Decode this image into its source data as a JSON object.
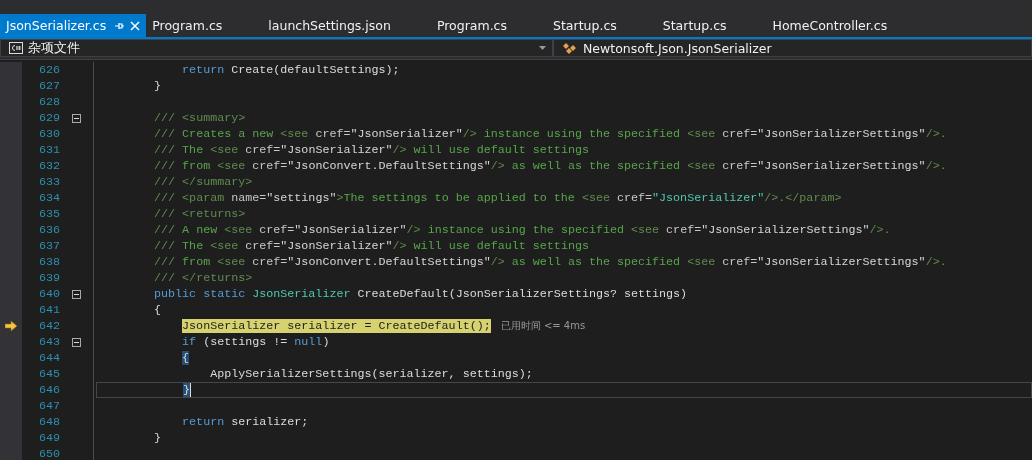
{
  "tabs": [
    {
      "label": "JsonSerializer.cs",
      "selected": true
    },
    {
      "label": "Program.cs",
      "selected": false
    },
    {
      "label": "launchSettings.json",
      "selected": false
    },
    {
      "label": "Program.cs",
      "selected": false
    },
    {
      "label": "Startup.cs",
      "selected": false
    },
    {
      "label": "Startup.cs",
      "selected": false
    },
    {
      "label": "HomeController.cs",
      "selected": false
    }
  ],
  "navigation_bar": {
    "project": "杂项文件",
    "type": "Newtonsoft.Json.JsonSerializer"
  },
  "editor": {
    "lines": [
      {
        "number": "626",
        "kind": "statement",
        "tokens": [
          {
            "kind": "kw",
            "text": "return"
          },
          {
            "kind": "plain",
            "text": " Create(defaultSettings);"
          }
        ]
      },
      {
        "number": "627",
        "kind": "member",
        "tokens": [
          {
            "kind": "plain",
            "text": "}"
          }
        ]
      },
      {
        "number": "628",
        "kind": "blank"
      },
      {
        "number": "629",
        "kind": "member",
        "fold": true,
        "tokens": [
          {
            "kind": "doc",
            "text": "/// <summary>"
          }
        ]
      },
      {
        "number": "630",
        "kind": "member",
        "tokens": [
          {
            "kind": "doc",
            "text": "/// "
          },
          {
            "kind": "doctext",
            "text": "Creates a new "
          },
          {
            "kind": "doc",
            "text": "<see "
          },
          {
            "kind": "attr",
            "text": "cref="
          },
          {
            "kind": "str",
            "text": "\"JsonSerializer\""
          },
          {
            "kind": "doc",
            "text": "/> "
          },
          {
            "kind": "doctext",
            "text": "instance using the specified "
          },
          {
            "kind": "doc",
            "text": "<see "
          },
          {
            "kind": "attr",
            "text": "cref="
          },
          {
            "kind": "str",
            "text": "\"JsonSerializerSettings\""
          },
          {
            "kind": "doc",
            "text": "/>."
          }
        ]
      },
      {
        "number": "631",
        "kind": "member",
        "tokens": [
          {
            "kind": "doc",
            "text": "/// "
          },
          {
            "kind": "doctext",
            "text": "The "
          },
          {
            "kind": "doc",
            "text": "<see "
          },
          {
            "kind": "attr",
            "text": "cref="
          },
          {
            "kind": "str",
            "text": "\"JsonSerializer\""
          },
          {
            "kind": "doc",
            "text": "/> "
          },
          {
            "kind": "doctext",
            "text": "will use default settings"
          }
        ]
      },
      {
        "number": "632",
        "kind": "member",
        "tokens": [
          {
            "kind": "doc",
            "text": "/// "
          },
          {
            "kind": "doctext",
            "text": "from "
          },
          {
            "kind": "doc",
            "text": "<see "
          },
          {
            "kind": "attr",
            "text": "cref="
          },
          {
            "kind": "str",
            "text": "\"JsonConvert.DefaultSettings\""
          },
          {
            "kind": "doc",
            "text": "/> "
          },
          {
            "kind": "doctext",
            "text": "as well as the specified "
          },
          {
            "kind": "doc",
            "text": "<see "
          },
          {
            "kind": "attr",
            "text": "cref="
          },
          {
            "kind": "str",
            "text": "\"JsonSerializerSettings\""
          },
          {
            "kind": "doc",
            "text": "/>."
          }
        ]
      },
      {
        "number": "633",
        "kind": "member",
        "tokens": [
          {
            "kind": "doc",
            "text": "/// </summary>"
          }
        ]
      },
      {
        "number": "634",
        "kind": "member",
        "tokens": [
          {
            "kind": "doc",
            "text": "/// <param "
          },
          {
            "kind": "attr",
            "text": "name="
          },
          {
            "kind": "str",
            "text": "\"settings\""
          },
          {
            "kind": "doc",
            "text": ">"
          },
          {
            "kind": "doctext",
            "text": "The settings to be applied to the "
          },
          {
            "kind": "doc",
            "text": "<see "
          },
          {
            "kind": "attr",
            "text": "cref="
          },
          {
            "kind": "ref",
            "text": "\"JsonSerializer\""
          },
          {
            "kind": "doc",
            "text": "/>.</param>"
          }
        ]
      },
      {
        "number": "635",
        "kind": "member",
        "tokens": [
          {
            "kind": "doc",
            "text": "/// <returns>"
          }
        ]
      },
      {
        "number": "636",
        "kind": "member",
        "tokens": [
          {
            "kind": "doc",
            "text": "/// "
          },
          {
            "kind": "doctext",
            "text": "A new "
          },
          {
            "kind": "doc",
            "text": "<see "
          },
          {
            "kind": "attr",
            "text": "cref="
          },
          {
            "kind": "str",
            "text": "\"JsonSerializer\""
          },
          {
            "kind": "doc",
            "text": "/> "
          },
          {
            "kind": "doctext",
            "text": "instance using the specified "
          },
          {
            "kind": "doc",
            "text": "<see "
          },
          {
            "kind": "attr",
            "text": "cref="
          },
          {
            "kind": "str",
            "text": "\"JsonSerializerSettings\""
          },
          {
            "kind": "doc",
            "text": "/>."
          }
        ]
      },
      {
        "number": "637",
        "kind": "member",
        "tokens": [
          {
            "kind": "doc",
            "text": "/// "
          },
          {
            "kind": "doctext",
            "text": "The "
          },
          {
            "kind": "doc",
            "text": "<see "
          },
          {
            "kind": "attr",
            "text": "cref="
          },
          {
            "kind": "str",
            "text": "\"JsonSerializer\""
          },
          {
            "kind": "doc",
            "text": "/> "
          },
          {
            "kind": "doctext",
            "text": "will use default settings"
          }
        ]
      },
      {
        "number": "638",
        "kind": "member",
        "tokens": [
          {
            "kind": "doc",
            "text": "/// "
          },
          {
            "kind": "doctext",
            "text": "from "
          },
          {
            "kind": "doc",
            "text": "<see "
          },
          {
            "kind": "attr",
            "text": "cref="
          },
          {
            "kind": "str",
            "text": "\"JsonConvert.DefaultSettings\""
          },
          {
            "kind": "doc",
            "text": "/> "
          },
          {
            "kind": "doctext",
            "text": "as well as the specified "
          },
          {
            "kind": "doc",
            "text": "<see "
          },
          {
            "kind": "attr",
            "text": "cref="
          },
          {
            "kind": "str",
            "text": "\"JsonSerializerSettings\""
          },
          {
            "kind": "doc",
            "text": "/>."
          }
        ]
      },
      {
        "number": "639",
        "kind": "member",
        "tokens": [
          {
            "kind": "doc",
            "text": "/// </returns>"
          }
        ]
      },
      {
        "number": "640",
        "kind": "member",
        "fold": true,
        "tokens": [
          {
            "kind": "kw",
            "text": "public static "
          },
          {
            "kind": "type",
            "text": "JsonSerializer"
          },
          {
            "kind": "plain",
            "text": " CreateDefault(JsonSerializerSettings? settings)"
          }
        ]
      },
      {
        "number": "641",
        "kind": "member",
        "tokens": [
          {
            "kind": "plain",
            "text": "{"
          }
        ]
      },
      {
        "number": "642",
        "kind": "statement",
        "current": true,
        "hint": "已用时间 <= 4ms",
        "tokens": [
          {
            "kind": "exec",
            "text": "JsonSerializer serializer = CreateDefault();"
          }
        ]
      },
      {
        "number": "643",
        "kind": "statement",
        "fold": true,
        "tokens": [
          {
            "kind": "kw",
            "text": "if"
          },
          {
            "kind": "plain",
            "text": " (settings != "
          },
          {
            "kind": "kw",
            "text": "null"
          },
          {
            "kind": "plain",
            "text": ")"
          }
        ]
      },
      {
        "number": "644",
        "kind": "statement",
        "tokens": [
          {
            "kind": "brace",
            "text": "{"
          }
        ]
      },
      {
        "number": "645",
        "kind": "nested",
        "tokens": [
          {
            "kind": "plain",
            "text": "ApplySerializerSettings(serializer, settings);"
          }
        ]
      },
      {
        "number": "646",
        "kind": "statement",
        "caret": true,
        "tokens": [
          {
            "kind": "brace",
            "text": "}"
          }
        ]
      },
      {
        "number": "647",
        "kind": "blank"
      },
      {
        "number": "648",
        "kind": "statement",
        "tokens": [
          {
            "kind": "kw",
            "text": "return"
          },
          {
            "kind": "plain",
            "text": " serializer;"
          }
        ]
      },
      {
        "number": "649",
        "kind": "member",
        "tokens": [
          {
            "kind": "plain",
            "text": "}"
          }
        ]
      },
      {
        "number": "650",
        "kind": "blank"
      }
    ]
  }
}
